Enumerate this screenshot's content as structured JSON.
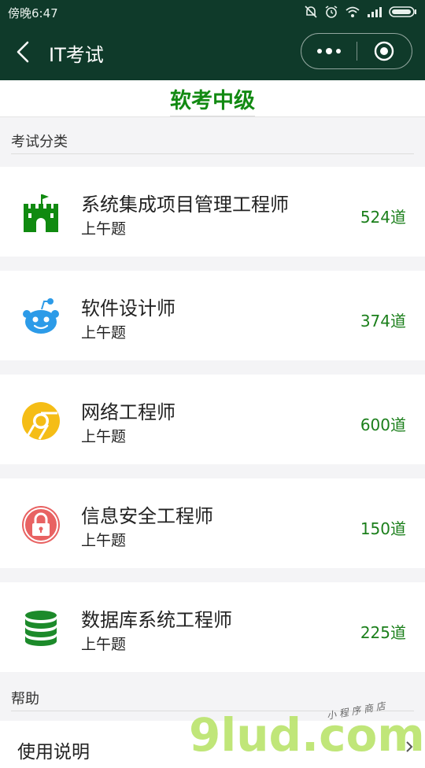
{
  "status_bar": {
    "time": "傍晚6:47"
  },
  "nav": {
    "title": "IT考试"
  },
  "page": {
    "title": "软考中级"
  },
  "sections": {
    "exam_category": "考试分类",
    "help": "帮助"
  },
  "cards": [
    {
      "name": "系统集成项目管理工程师",
      "subtitle": "上午题",
      "count": "524道",
      "icon": "castle-icon"
    },
    {
      "name": "软件设计师",
      "subtitle": "上午题",
      "count": "374道",
      "icon": "robot-icon"
    },
    {
      "name": "网络工程师",
      "subtitle": "上午题",
      "count": "600道",
      "icon": "chrome-icon"
    },
    {
      "name": "信息安全工程师",
      "subtitle": "上午题",
      "count": "150道",
      "icon": "lock-icon"
    },
    {
      "name": "数据库系统工程师",
      "subtitle": "上午题",
      "count": "225道",
      "icon": "database-icon"
    }
  ],
  "help_items": [
    {
      "label": "使用说明"
    }
  ],
  "watermark": {
    "main": "9lud.com",
    "tagline": "小 程 序 商 店"
  },
  "colors": {
    "header": "#0f3a2a",
    "accent_green": "#128a12",
    "count_green": "#1b7f1b"
  }
}
